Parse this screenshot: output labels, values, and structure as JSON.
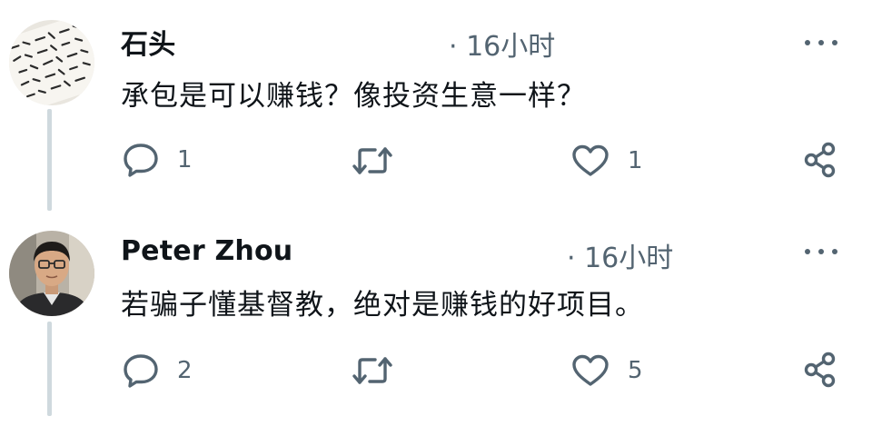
{
  "tweets": [
    {
      "author": "石头",
      "time": "· 16小时",
      "text": "承包是可以赚钱？像投资生意一样？",
      "replies": "1",
      "retweets": "",
      "likes": "1"
    },
    {
      "author": "Peter Zhou",
      "time": "· 16小时",
      "text": "若骗子懂基督教，绝对是赚钱的好项目。",
      "replies": "2",
      "retweets": "",
      "likes": "5"
    }
  ],
  "icons": {
    "reply": "speech-bubble-icon",
    "retweet": "retweet-icon",
    "like": "heart-icon",
    "share": "share-icon",
    "more": "more-dots-icon"
  },
  "colors": {
    "icon_gray": "#536471",
    "thread_line": "#cfd9de"
  }
}
